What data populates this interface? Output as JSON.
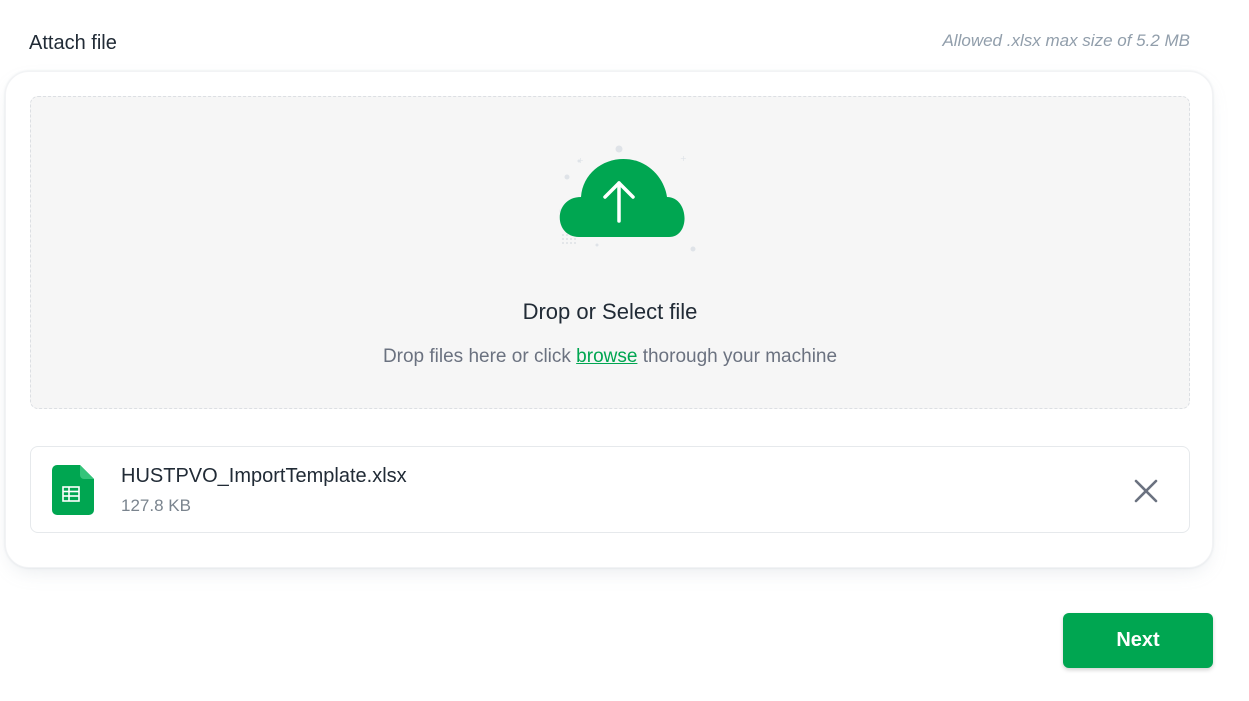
{
  "header": {
    "title": "Attach file",
    "allowed_note": "Allowed .xlsx max size of 5.2 MB"
  },
  "dropzone": {
    "title": "Drop or Select file",
    "subtitle_before": "Drop files here or click ",
    "browse_link": "browse",
    "subtitle_after": " thorough your machine",
    "icon": "cloud-upload-icon"
  },
  "file": {
    "name": "HUSTPVO_ImportTemplate.xlsx",
    "size": "127.8 KB",
    "icon": "spreadsheet-file-icon"
  },
  "actions": {
    "remove_icon": "close-icon",
    "next_label": "Next"
  },
  "colors": {
    "accent": "#00a651",
    "dropzone_bg": "#f6f6f6"
  }
}
